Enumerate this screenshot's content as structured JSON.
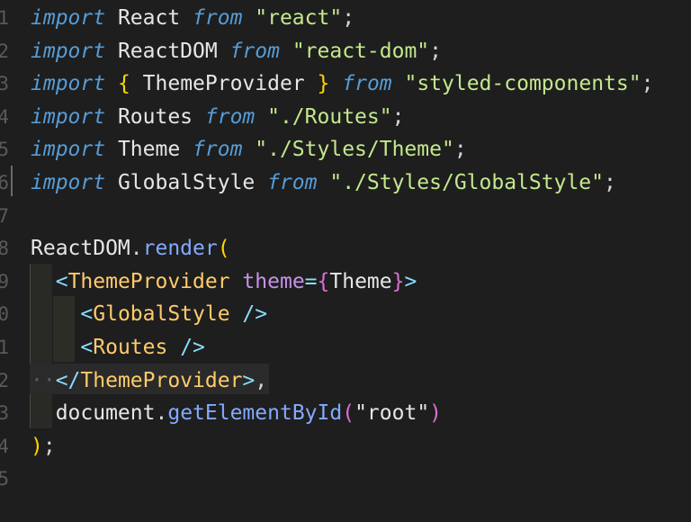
{
  "editor": {
    "line_numbers": [
      "1",
      "2",
      "3",
      "4",
      "5",
      "6",
      "7",
      "8",
      "9",
      "0",
      "1",
      "2",
      "3",
      "4",
      "5"
    ],
    "lines": [
      [
        {
          "t": "import",
          "c": "kw"
        },
        {
          "t": " React ",
          "c": "id"
        },
        {
          "t": "from",
          "c": "kw"
        },
        {
          "t": " \"react\"",
          "c": "str-g"
        },
        {
          "t": ";",
          "c": "pun"
        }
      ],
      [
        {
          "t": "import",
          "c": "kw"
        },
        {
          "t": " ReactDOM ",
          "c": "id"
        },
        {
          "t": "from",
          "c": "kw"
        },
        {
          "t": " \"react-dom\"",
          "c": "str-g"
        },
        {
          "t": ";",
          "c": "pun"
        }
      ],
      [
        {
          "t": "import",
          "c": "kw"
        },
        {
          "t": " ",
          "c": "id"
        },
        {
          "t": "{",
          "c": "brace"
        },
        {
          "t": " ThemeProvider ",
          "c": "id"
        },
        {
          "t": "}",
          "c": "brace"
        },
        {
          "t": " ",
          "c": "id"
        },
        {
          "t": "from",
          "c": "kw"
        },
        {
          "t": " \"styled-components\"",
          "c": "str-g"
        },
        {
          "t": ";",
          "c": "pun"
        }
      ],
      [
        {
          "t": "import",
          "c": "kw"
        },
        {
          "t": " Routes ",
          "c": "id"
        },
        {
          "t": "from",
          "c": "kw"
        },
        {
          "t": " \"./Routes\"",
          "c": "str-g"
        },
        {
          "t": ";",
          "c": "pun"
        }
      ],
      [
        {
          "t": "import",
          "c": "kw"
        },
        {
          "t": " Theme ",
          "c": "id"
        },
        {
          "t": "from",
          "c": "kw"
        },
        {
          "t": " \"./Styles/Theme\"",
          "c": "str-g"
        },
        {
          "t": ";",
          "c": "pun"
        }
      ],
      [
        {
          "t": "import",
          "c": "kw"
        },
        {
          "t": " GlobalStyle ",
          "c": "id"
        },
        {
          "t": "from",
          "c": "kw"
        },
        {
          "t": " \"./Styles/GlobalStyle\"",
          "c": "str-g"
        },
        {
          "t": ";",
          "c": "pun"
        }
      ],
      [],
      [
        {
          "t": "ReactDOM",
          "c": "id"
        },
        {
          "t": ".",
          "c": "pun"
        },
        {
          "t": "render",
          "c": "fn"
        },
        {
          "t": "(",
          "c": "paren-y"
        }
      ],
      [
        {
          "t": "  ",
          "c": "id"
        },
        {
          "t": "<",
          "c": "angle"
        },
        {
          "t": "ThemeProvider",
          "c": "tag"
        },
        {
          "t": " theme",
          "c": "attr"
        },
        {
          "t": "=",
          "c": "angle"
        },
        {
          "t": "{",
          "c": "paren-p"
        },
        {
          "t": "Theme",
          "c": "id"
        },
        {
          "t": "}",
          "c": "paren-p"
        },
        {
          "t": ">",
          "c": "angle"
        }
      ],
      [
        {
          "t": "    ",
          "c": "id"
        },
        {
          "t": "<",
          "c": "angle"
        },
        {
          "t": "GlobalStyle",
          "c": "tag"
        },
        {
          "t": " />",
          "c": "angle"
        }
      ],
      [
        {
          "t": "    ",
          "c": "id"
        },
        {
          "t": "<",
          "c": "angle"
        },
        {
          "t": "Routes",
          "c": "tag"
        },
        {
          "t": " />",
          "c": "angle"
        }
      ],
      [
        {
          "t": "··",
          "c": "dots"
        },
        {
          "t": "</",
          "c": "angle"
        },
        {
          "t": "ThemeProvider",
          "c": "tag"
        },
        {
          "t": ">",
          "c": "angle"
        },
        {
          "t": ",",
          "c": "pun"
        }
      ],
      [
        {
          "t": "  document",
          "c": "id"
        },
        {
          "t": ".",
          "c": "pun"
        },
        {
          "t": "getElementById",
          "c": "fn"
        },
        {
          "t": "(",
          "c": "paren-p"
        },
        {
          "t": "\"root\"",
          "c": "id"
        },
        {
          "t": ")",
          "c": "paren-p"
        }
      ],
      [
        {
          "t": ")",
          "c": "paren-y"
        },
        {
          "t": ";",
          "c": "pun"
        }
      ],
      []
    ]
  }
}
